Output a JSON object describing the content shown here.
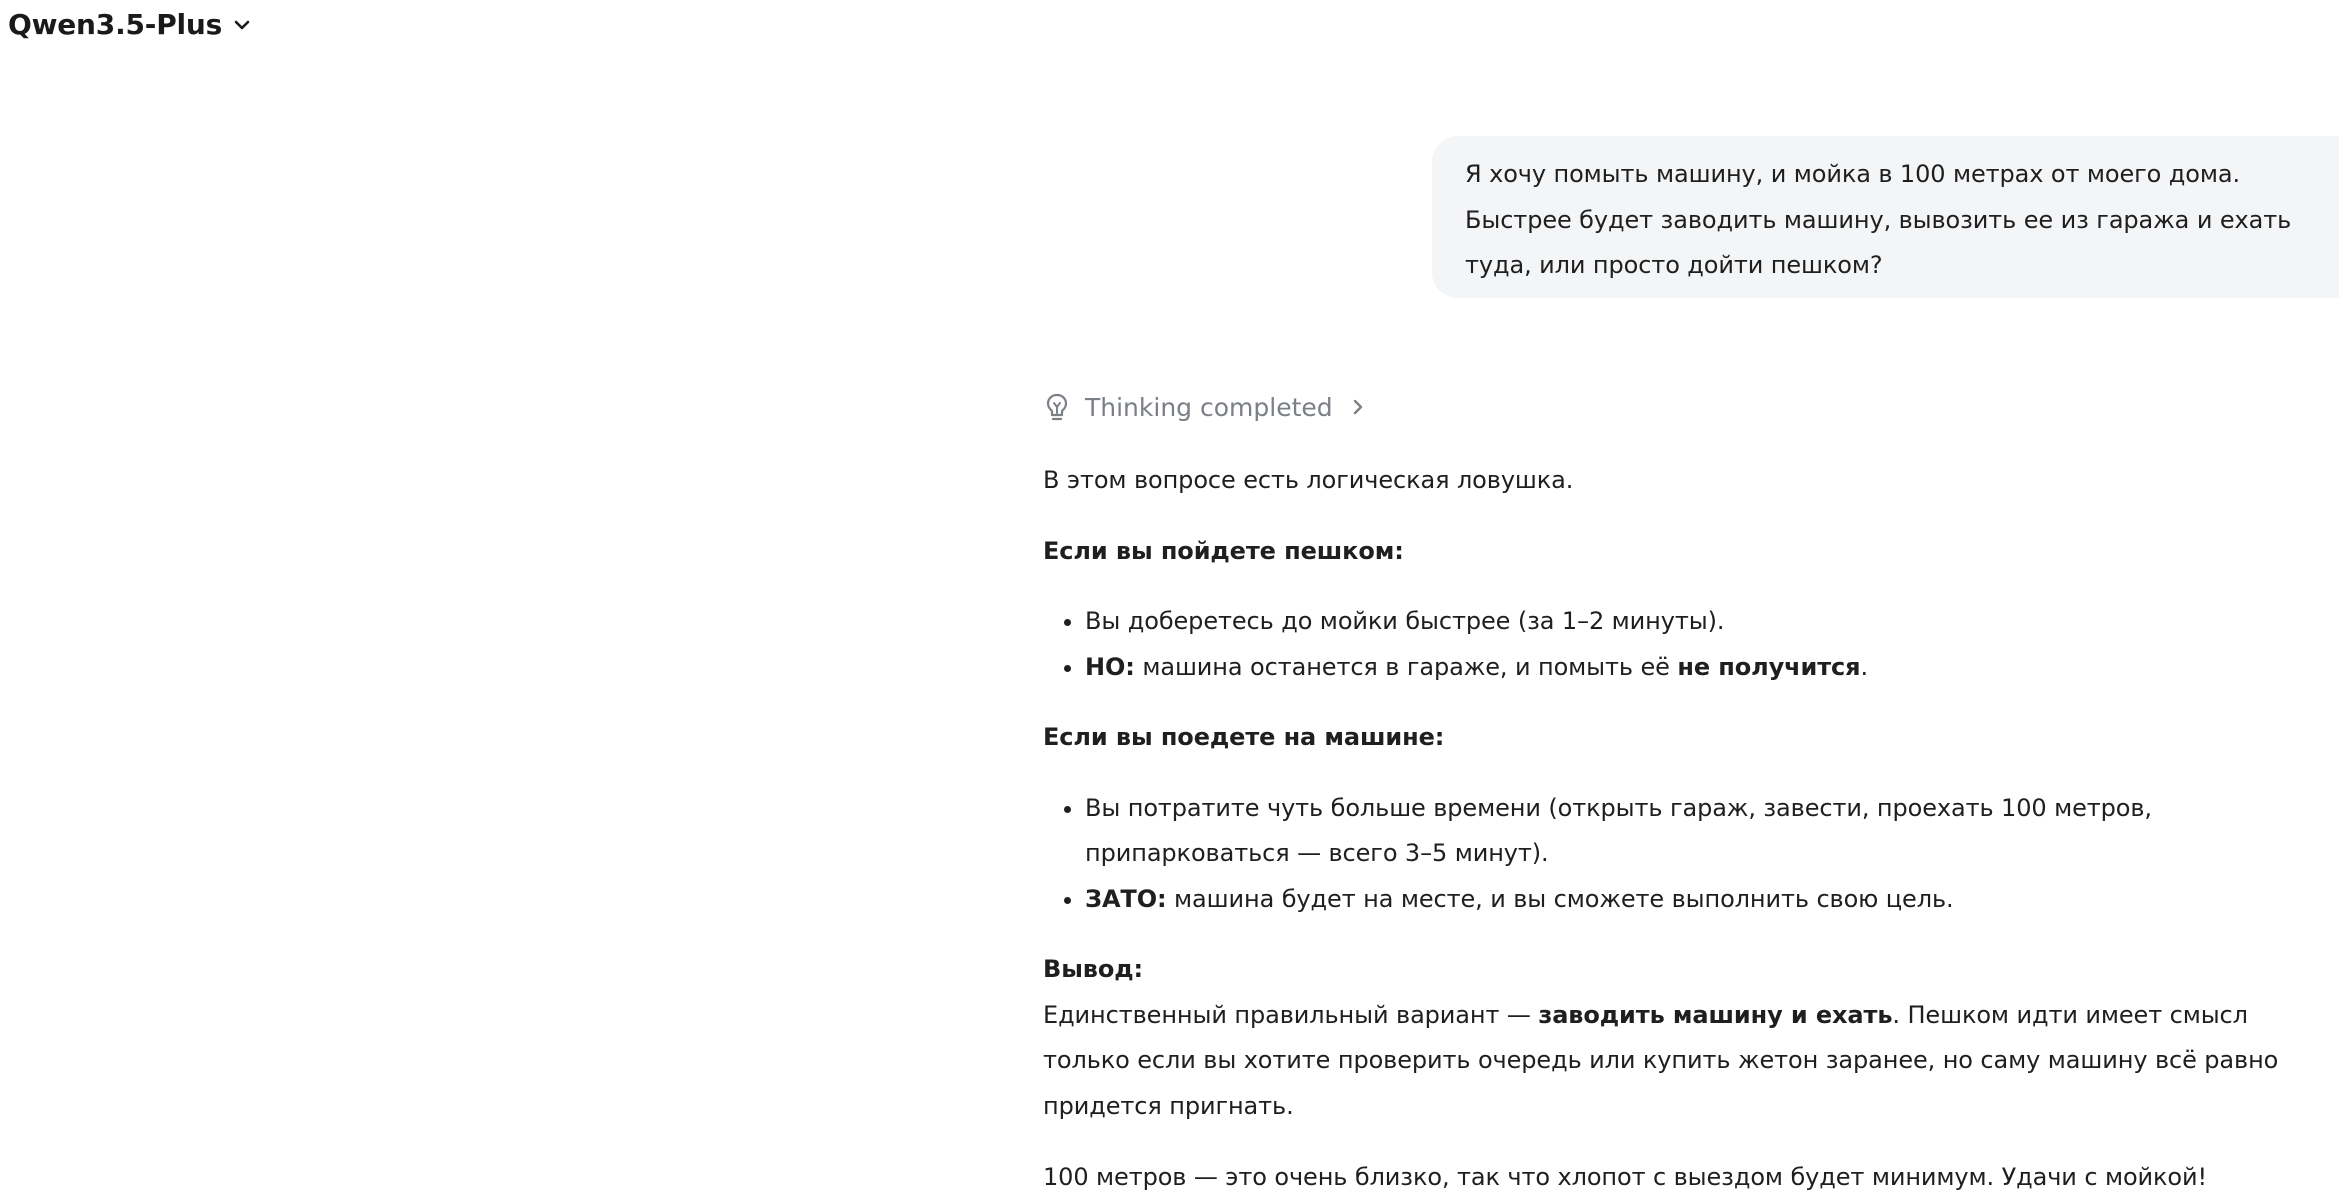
{
  "header": {
    "model_name": "Qwen3.5-Plus"
  },
  "user_message": {
    "text": "Я хочу помыть машину, и мойка в 100 метрах от моего  дома. Быстрее будет заводить машину, вывозить ее из  гаража и ехать туда, или просто дойти пешком?"
  },
  "thinking": {
    "label": "Thinking completed"
  },
  "response": {
    "intro": "В этом вопросе есть логическая ловушка.",
    "walk": {
      "heading": "Если вы пойдете пешком:",
      "item1": "Вы доберетесь до мойки быстрее (за 1–2 минуты).",
      "item2_bold": "НО:",
      "item2_mid": " машина останется в гараже, и помыть её ",
      "item2_bold_end": "не получится",
      "item2_end": "."
    },
    "drive": {
      "heading": "Если вы поедете на машине:",
      "item1": "Вы потратите чуть больше времени (открыть гараж, завести, проехать 100 метров, припарковаться — всего 3–5 минут).",
      "item2_bold": "ЗАТО:",
      "item2_rest": " машина будет на месте, и вы сможете выполнить свою цель."
    },
    "conclusion": {
      "heading": "Вывод:",
      "text_start": "Единственный правильный вариант — ",
      "text_bold": "заводить машину и ехать",
      "text_end": ". Пешком идти имеет смысл только если вы хотите проверить очередь или купить жетон заранее, но саму машину всё равно придется пригнать."
    },
    "closing": "100 метров — это очень близко, так что хлопот с выездом будет минимум. Удачи с мойкой!"
  }
}
